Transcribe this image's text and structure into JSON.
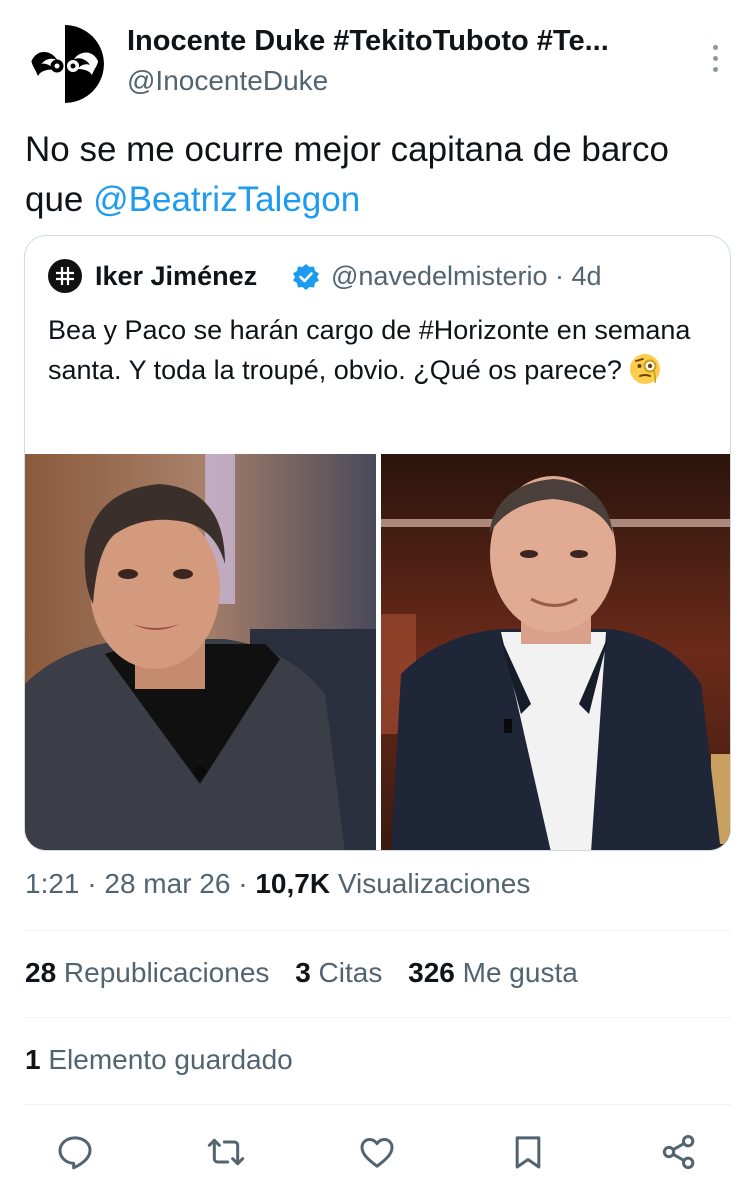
{
  "author": {
    "display_name": "Inocente Duke #TekitoTuboto #Te...",
    "handle": "@InocenteDuke",
    "avatar_icon": "bird-circle-logo-icon"
  },
  "tweet": {
    "text_before": "No se me ocurre mejor capitana de barco que ",
    "mention": "@BeatrizTalegon"
  },
  "quoted": {
    "name": "Iker Jiménez",
    "handle_time": "@navedelmisterio · 4d",
    "text": "Bea y Paco se harán cargo de #Horizonte en semana santa. Y toda la troupé, obvio. ¿Qué os parece? ",
    "emoji_icon": "face-with-monocle-icon",
    "photos": [
      "woman-photo",
      "man-photo"
    ]
  },
  "meta": {
    "time_date": "1:21 · 28 mar 26 · ",
    "views_count": "10,7K",
    "views_label": " Visualizaciones"
  },
  "stats": {
    "reposts_count": "28",
    "reposts_label": " Republicaciones",
    "quotes_count": "3",
    "quotes_label": " Citas",
    "likes_count": "326",
    "likes_label": " Me gusta"
  },
  "bookmarks": {
    "count": "1",
    "label": " Elemento guardado"
  },
  "colors": {
    "accent": "#1d9bf0",
    "secondary_text": "#536471",
    "border": "#cfd9de"
  }
}
